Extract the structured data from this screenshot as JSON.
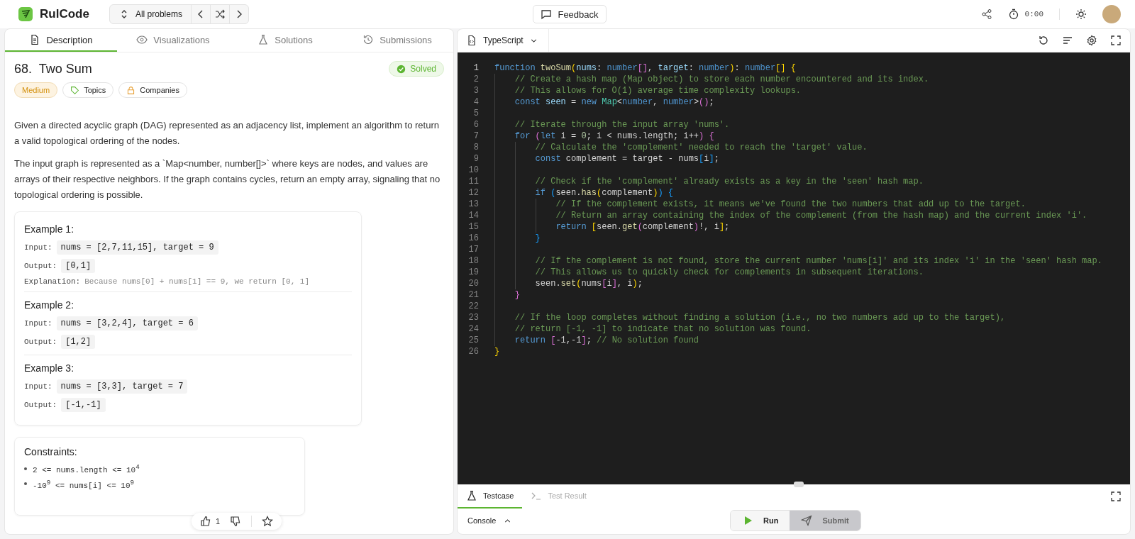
{
  "header": {
    "brand": "RulCode",
    "problem_list": "All problems",
    "feedback": "Feedback",
    "timer": "0:00"
  },
  "left_tabs": [
    {
      "label": "Description",
      "selected": true
    },
    {
      "label": "Visualizations",
      "selected": false
    },
    {
      "label": "Solutions",
      "selected": false
    },
    {
      "label": "Submissions",
      "selected": false
    }
  ],
  "problem": {
    "title": "68.  Two Sum",
    "status": "Solved",
    "difficulty": "Medium",
    "tags": [
      "Topics",
      "Companies"
    ],
    "description": [
      "Given a directed acyclic graph (DAG) represented as an adjacency list, implement an algorithm to return a valid topological ordering of the nodes.",
      "The input graph is represented as a `Map<number, number[]>` where keys are nodes, and values are arrays of their respective neighbors. If the graph contains cycles, return an empty array, signaling that no topological ordering is possible."
    ],
    "examples": [
      {
        "title": "Example 1:",
        "rows": [
          {
            "label": "Input:",
            "value": "nums = [2,7,11,15], target = 9",
            "kind": "code"
          },
          {
            "label": "Output:",
            "value": "[0,1]",
            "kind": "code"
          },
          {
            "label": "Explanation:",
            "value": "Because nums[0] + nums[1] == 9, we return [0, 1]",
            "kind": "note"
          }
        ]
      },
      {
        "title": "Example 2:",
        "rows": [
          {
            "label": "Input:",
            "value": "nums = [3,2,4], target = 6",
            "kind": "code"
          },
          {
            "label": "Output:",
            "value": "[1,2]",
            "kind": "code"
          }
        ]
      },
      {
        "title": "Example 3:",
        "rows": [
          {
            "label": "Input:",
            "value": "nums = [3,3], target = 7",
            "kind": "code"
          },
          {
            "label": "Output:",
            "value": "[-1,-1]",
            "kind": "code"
          }
        ]
      }
    ],
    "constraints_title": "Constraints:",
    "constraints": [
      "2 <= nums.length <= 10$^{4}$",
      "-10$^{9}$ <= nums[i] <= 10$^{9}$"
    ],
    "likes": "1"
  },
  "editor": {
    "language": "TypeScript",
    "lines": [
      {
        "number": "1",
        "tokens": [
          {
            "kind": "kw",
            "text": "function"
          },
          {
            "kind": "fn",
            "text": " twoSum"
          },
          {
            "kind": "br1",
            "text": "("
          },
          {
            "kind": "var",
            "text": "nums"
          },
          {
            "kind": "plain",
            "text": ": "
          },
          {
            "kind": "type",
            "text": "number"
          },
          {
            "kind": "br2",
            "text": "[]"
          },
          {
            "kind": "plain",
            "text": ", "
          },
          {
            "kind": "var",
            "text": "target"
          },
          {
            "kind": "plain",
            "text": ": "
          },
          {
            "kind": "type",
            "text": "number"
          },
          {
            "kind": "br1",
            "text": ")"
          },
          {
            "kind": "plain",
            "text": ": "
          },
          {
            "kind": "type",
            "text": "number"
          },
          {
            "kind": "br1",
            "text": "[] {"
          }
        ],
        "children": [
          {
            "number": "2",
            "tokens": [
              {
                "kind": "cm",
                "text": "// Create a hash map (Map object) to store each number encountered and its index."
              }
            ]
          },
          {
            "number": "3",
            "tokens": [
              {
                "kind": "cm",
                "text": "// This allows for O(1) average time complexity lookups."
              }
            ]
          },
          {
            "number": "4",
            "tokens": [
              {
                "kind": "kw",
                "text": "const"
              },
              {
                "kind": "var",
                "text": " seen"
              },
              {
                "kind": "plain",
                "text": " = "
              },
              {
                "kind": "kw",
                "text": "new"
              },
              {
                "kind": "cls",
                "text": " Map"
              },
              {
                "kind": "plain",
                "text": "<"
              },
              {
                "kind": "type",
                "text": "number"
              },
              {
                "kind": "plain",
                "text": ", "
              },
              {
                "kind": "type",
                "text": "number"
              },
              {
                "kind": "plain",
                "text": ">"
              },
              {
                "kind": "br2",
                "text": "()"
              },
              {
                "kind": "plain",
                "text": ";"
              }
            ]
          },
          {
            "number": "5"
          },
          {
            "number": "6",
            "tokens": [
              {
                "kind": "cm",
                "text": "// Iterate through the input array 'nums'."
              }
            ]
          },
          {
            "number": "7",
            "tokens": [
              {
                "kind": "kw",
                "text": "for"
              },
              {
                "kind": "br2",
                "text": " ("
              },
              {
                "kind": "kw",
                "text": "let"
              },
              {
                "kind": "plain",
                "text": " i = "
              },
              {
                "kind": "num",
                "text": "0"
              },
              {
                "kind": "plain",
                "text": "; i < nums.length; i++"
              },
              {
                "kind": "br2",
                "text": ") {"
              }
            ],
            "children": [
              {
                "number": "8",
                "tokens": [
                  {
                    "kind": "cm",
                    "text": "// Calculate the 'complement' needed to reach the 'target' value."
                  }
                ]
              },
              {
                "number": "9",
                "tokens": [
                  {
                    "kind": "kw",
                    "text": "const"
                  },
                  {
                    "kind": "plain",
                    "text": " complement = target - nums"
                  },
                  {
                    "kind": "br3",
                    "text": "["
                  },
                  {
                    "kind": "plain",
                    "text": "i"
                  },
                  {
                    "kind": "br3",
                    "text": "]"
                  },
                  {
                    "kind": "plain",
                    "text": ";"
                  }
                ]
              },
              {
                "number": "10"
              },
              {
                "number": "11",
                "tokens": [
                  {
                    "kind": "cm",
                    "text": "// Check if the 'complement' already exists as a key in the 'seen' hash map."
                  }
                ]
              },
              {
                "number": "12",
                "tokens": [
                  {
                    "kind": "kw",
                    "text": "if"
                  },
                  {
                    "kind": "br3",
                    "text": " ("
                  },
                  {
                    "kind": "plain",
                    "text": "seen."
                  },
                  {
                    "kind": "fn",
                    "text": "has"
                  },
                  {
                    "kind": "br1",
                    "text": "("
                  },
                  {
                    "kind": "plain",
                    "text": "complement"
                  },
                  {
                    "kind": "br1",
                    "text": ")"
                  },
                  {
                    "kind": "br3",
                    "text": ") {"
                  }
                ],
                "children": [
                  {
                    "number": "13",
                    "tokens": [
                      {
                        "kind": "cm",
                        "text": "// If the complement exists, it means we've found the two numbers that add up to the target."
                      }
                    ]
                  },
                  {
                    "number": "14",
                    "tokens": [
                      {
                        "kind": "cm",
                        "text": "// Return an array containing the index of the complement (from the hash map) and the current index 'i'."
                      }
                    ]
                  },
                  {
                    "number": "15",
                    "tokens": [
                      {
                        "kind": "kw",
                        "text": "return"
                      },
                      {
                        "kind": "br1",
                        "text": " ["
                      },
                      {
                        "kind": "plain",
                        "text": "seen."
                      },
                      {
                        "kind": "fn",
                        "text": "get"
                      },
                      {
                        "kind": "br2",
                        "text": "("
                      },
                      {
                        "kind": "plain",
                        "text": "complement"
                      },
                      {
                        "kind": "br2",
                        "text": ")"
                      },
                      {
                        "kind": "plain",
                        "text": "!, i"
                      },
                      {
                        "kind": "br1",
                        "text": "]"
                      },
                      {
                        "kind": "plain",
                        "text": ";"
                      }
                    ]
                  }
                ]
              },
              {
                "number": "16",
                "tokens": [
                  {
                    "kind": "br3",
                    "text": "}"
                  }
                ]
              },
              {
                "number": "17"
              },
              {
                "number": "18",
                "tokens": [
                  {
                    "kind": "cm",
                    "text": "// If the complement is not found, store the current number 'nums[i]' and its index 'i' in the 'seen' hash map."
                  }
                ]
              },
              {
                "number": "19",
                "tokens": [
                  {
                    "kind": "cm",
                    "text": "// This allows us to quickly check for complements in subsequent iterations."
                  }
                ]
              },
              {
                "number": "20",
                "tokens": [
                  {
                    "kind": "plain",
                    "text": "seen."
                  },
                  {
                    "kind": "fn",
                    "text": "set"
                  },
                  {
                    "kind": "br1",
                    "text": "("
                  },
                  {
                    "kind": "plain",
                    "text": "nums"
                  },
                  {
                    "kind": "br2",
                    "text": "["
                  },
                  {
                    "kind": "plain",
                    "text": "i"
                  },
                  {
                    "kind": "br2",
                    "text": "]"
                  },
                  {
                    "kind": "plain",
                    "text": ", i"
                  },
                  {
                    "kind": "br1",
                    "text": ")"
                  },
                  {
                    "kind": "plain",
                    "text": ";"
                  }
                ]
              }
            ]
          },
          {
            "number": "21",
            "tokens": [
              {
                "kind": "br2",
                "text": "}"
              }
            ]
          },
          {
            "number": "22"
          },
          {
            "number": "23",
            "tokens": [
              {
                "kind": "cm",
                "text": "// If the loop completes without finding a solution (i.e., no two numbers add up to the target),"
              }
            ]
          },
          {
            "number": "24",
            "tokens": [
              {
                "kind": "cm",
                "text": "// return [-1, -1] to indicate that no solution was found."
              }
            ]
          },
          {
            "number": "25",
            "tokens": [
              {
                "kind": "kw",
                "text": "return"
              },
              {
                "kind": "br2",
                "text": " ["
              },
              {
                "kind": "plain",
                "text": "-1,-1"
              },
              {
                "kind": "br2",
                "text": "]"
              },
              {
                "kind": "plain",
                "text": ";"
              },
              {
                "kind": "cm",
                "text": " // No solution found"
              }
            ]
          }
        ]
      },
      {
        "number": "26",
        "tokens": [
          {
            "kind": "br1",
            "text": "}"
          }
        ]
      }
    ]
  },
  "bottom_tabs": [
    {
      "label": "Testcase",
      "selected": true
    },
    {
      "label": "Test Result",
      "selected": false
    }
  ],
  "console": "Console",
  "run": "Run",
  "submit": "Submit"
}
